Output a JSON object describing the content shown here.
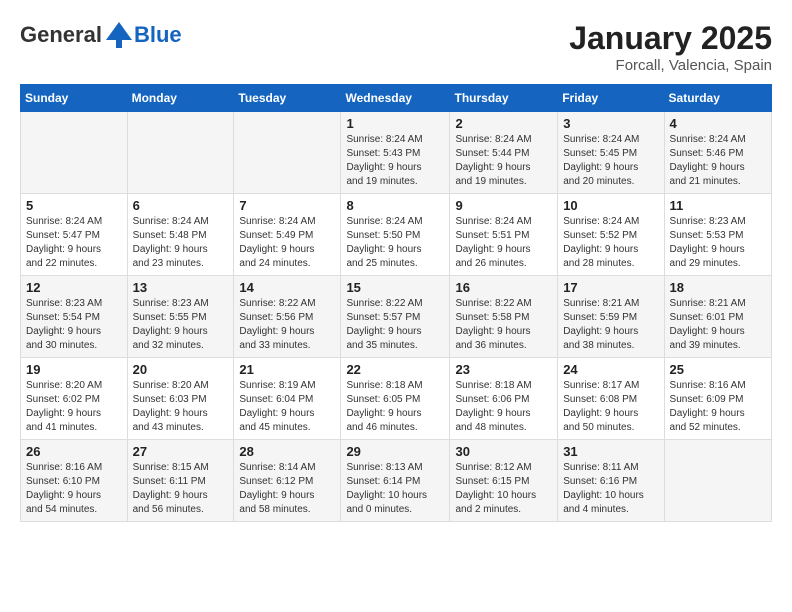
{
  "header": {
    "logo_general": "General",
    "logo_blue": "Blue",
    "month_title": "January 2025",
    "location": "Forcall, Valencia, Spain"
  },
  "days_of_week": [
    "Sunday",
    "Monday",
    "Tuesday",
    "Wednesday",
    "Thursday",
    "Friday",
    "Saturday"
  ],
  "weeks": [
    [
      {
        "day": "",
        "info": ""
      },
      {
        "day": "",
        "info": ""
      },
      {
        "day": "",
        "info": ""
      },
      {
        "day": "1",
        "info": "Sunrise: 8:24 AM\nSunset: 5:43 PM\nDaylight: 9 hours\nand 19 minutes."
      },
      {
        "day": "2",
        "info": "Sunrise: 8:24 AM\nSunset: 5:44 PM\nDaylight: 9 hours\nand 19 minutes."
      },
      {
        "day": "3",
        "info": "Sunrise: 8:24 AM\nSunset: 5:45 PM\nDaylight: 9 hours\nand 20 minutes."
      },
      {
        "day": "4",
        "info": "Sunrise: 8:24 AM\nSunset: 5:46 PM\nDaylight: 9 hours\nand 21 minutes."
      }
    ],
    [
      {
        "day": "5",
        "info": "Sunrise: 8:24 AM\nSunset: 5:47 PM\nDaylight: 9 hours\nand 22 minutes."
      },
      {
        "day": "6",
        "info": "Sunrise: 8:24 AM\nSunset: 5:48 PM\nDaylight: 9 hours\nand 23 minutes."
      },
      {
        "day": "7",
        "info": "Sunrise: 8:24 AM\nSunset: 5:49 PM\nDaylight: 9 hours\nand 24 minutes."
      },
      {
        "day": "8",
        "info": "Sunrise: 8:24 AM\nSunset: 5:50 PM\nDaylight: 9 hours\nand 25 minutes."
      },
      {
        "day": "9",
        "info": "Sunrise: 8:24 AM\nSunset: 5:51 PM\nDaylight: 9 hours\nand 26 minutes."
      },
      {
        "day": "10",
        "info": "Sunrise: 8:24 AM\nSunset: 5:52 PM\nDaylight: 9 hours\nand 28 minutes."
      },
      {
        "day": "11",
        "info": "Sunrise: 8:23 AM\nSunset: 5:53 PM\nDaylight: 9 hours\nand 29 minutes."
      }
    ],
    [
      {
        "day": "12",
        "info": "Sunrise: 8:23 AM\nSunset: 5:54 PM\nDaylight: 9 hours\nand 30 minutes."
      },
      {
        "day": "13",
        "info": "Sunrise: 8:23 AM\nSunset: 5:55 PM\nDaylight: 9 hours\nand 32 minutes."
      },
      {
        "day": "14",
        "info": "Sunrise: 8:22 AM\nSunset: 5:56 PM\nDaylight: 9 hours\nand 33 minutes."
      },
      {
        "day": "15",
        "info": "Sunrise: 8:22 AM\nSunset: 5:57 PM\nDaylight: 9 hours\nand 35 minutes."
      },
      {
        "day": "16",
        "info": "Sunrise: 8:22 AM\nSunset: 5:58 PM\nDaylight: 9 hours\nand 36 minutes."
      },
      {
        "day": "17",
        "info": "Sunrise: 8:21 AM\nSunset: 5:59 PM\nDaylight: 9 hours\nand 38 minutes."
      },
      {
        "day": "18",
        "info": "Sunrise: 8:21 AM\nSunset: 6:01 PM\nDaylight: 9 hours\nand 39 minutes."
      }
    ],
    [
      {
        "day": "19",
        "info": "Sunrise: 8:20 AM\nSunset: 6:02 PM\nDaylight: 9 hours\nand 41 minutes."
      },
      {
        "day": "20",
        "info": "Sunrise: 8:20 AM\nSunset: 6:03 PM\nDaylight: 9 hours\nand 43 minutes."
      },
      {
        "day": "21",
        "info": "Sunrise: 8:19 AM\nSunset: 6:04 PM\nDaylight: 9 hours\nand 45 minutes."
      },
      {
        "day": "22",
        "info": "Sunrise: 8:18 AM\nSunset: 6:05 PM\nDaylight: 9 hours\nand 46 minutes."
      },
      {
        "day": "23",
        "info": "Sunrise: 8:18 AM\nSunset: 6:06 PM\nDaylight: 9 hours\nand 48 minutes."
      },
      {
        "day": "24",
        "info": "Sunrise: 8:17 AM\nSunset: 6:08 PM\nDaylight: 9 hours\nand 50 minutes."
      },
      {
        "day": "25",
        "info": "Sunrise: 8:16 AM\nSunset: 6:09 PM\nDaylight: 9 hours\nand 52 minutes."
      }
    ],
    [
      {
        "day": "26",
        "info": "Sunrise: 8:16 AM\nSunset: 6:10 PM\nDaylight: 9 hours\nand 54 minutes."
      },
      {
        "day": "27",
        "info": "Sunrise: 8:15 AM\nSunset: 6:11 PM\nDaylight: 9 hours\nand 56 minutes."
      },
      {
        "day": "28",
        "info": "Sunrise: 8:14 AM\nSunset: 6:12 PM\nDaylight: 9 hours\nand 58 minutes."
      },
      {
        "day": "29",
        "info": "Sunrise: 8:13 AM\nSunset: 6:14 PM\nDaylight: 10 hours\nand 0 minutes."
      },
      {
        "day": "30",
        "info": "Sunrise: 8:12 AM\nSunset: 6:15 PM\nDaylight: 10 hours\nand 2 minutes."
      },
      {
        "day": "31",
        "info": "Sunrise: 8:11 AM\nSunset: 6:16 PM\nDaylight: 10 hours\nand 4 minutes."
      },
      {
        "day": "",
        "info": ""
      }
    ]
  ]
}
